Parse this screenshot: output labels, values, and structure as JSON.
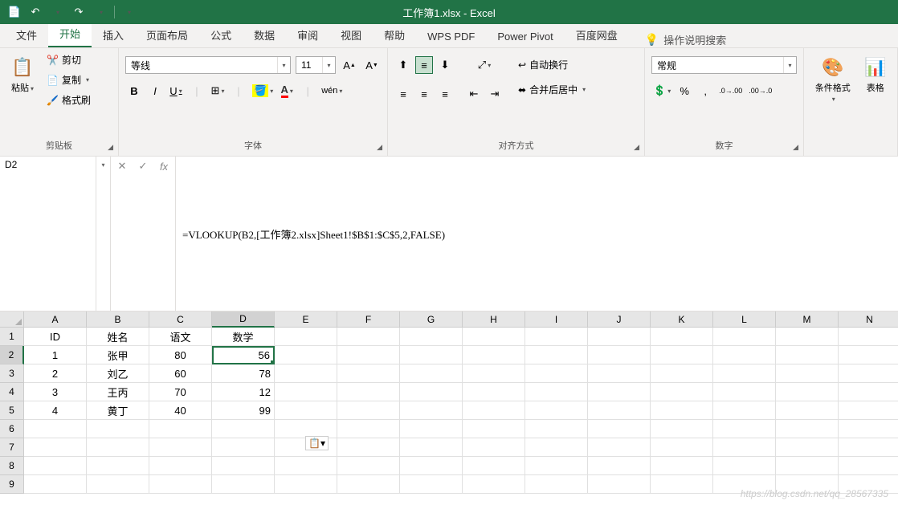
{
  "title": "工作簿1.xlsx - Excel",
  "qat": {
    "save": "💾",
    "undo": "↶",
    "redo": "↷"
  },
  "tabs": [
    "文件",
    "开始",
    "插入",
    "页面布局",
    "公式",
    "数据",
    "审阅",
    "视图",
    "帮助",
    "WPS PDF",
    "Power Pivot",
    "百度网盘"
  ],
  "active_tab": "开始",
  "tell_me": "操作说明搜索",
  "groups": {
    "clipboard": {
      "label": "剪贴板",
      "paste": "粘贴",
      "cut": "剪切",
      "copy": "复制",
      "painter": "格式刷"
    },
    "font": {
      "label": "字体",
      "name": "等线",
      "size": "11",
      "bold": "B",
      "italic": "I",
      "underline": "U"
    },
    "align": {
      "label": "对齐方式",
      "wrap": "自动换行",
      "merge": "合并后居中"
    },
    "number": {
      "label": "数字",
      "format": "常规"
    },
    "cond": {
      "label": "条件格式",
      "table": "表格"
    }
  },
  "name_box": "D2",
  "formula": "=VLOOKUP(B2,[工作簿2.xlsx]Sheet1!$B$1:$C$5,2,FALSE)",
  "columns": [
    "A",
    "B",
    "C",
    "D",
    "E",
    "F",
    "G",
    "H",
    "I",
    "J",
    "K",
    "L",
    "M",
    "N"
  ],
  "active_col": "D",
  "active_row": 2,
  "headers": [
    "ID",
    "姓名",
    "语文",
    "数学"
  ],
  "rows": [
    {
      "id": "1",
      "name": "张甲",
      "c": "80",
      "d": "56"
    },
    {
      "id": "2",
      "name": "刘乙",
      "c": "60",
      "d": "78"
    },
    {
      "id": "3",
      "name": "王丙",
      "c": "70",
      "d": "12"
    },
    {
      "id": "4",
      "name": "黄丁",
      "c": "40",
      "d": "99"
    }
  ],
  "extra_rows": [
    6,
    7,
    8,
    9
  ],
  "watermark": "https://blog.csdn.net/qq_28567335"
}
